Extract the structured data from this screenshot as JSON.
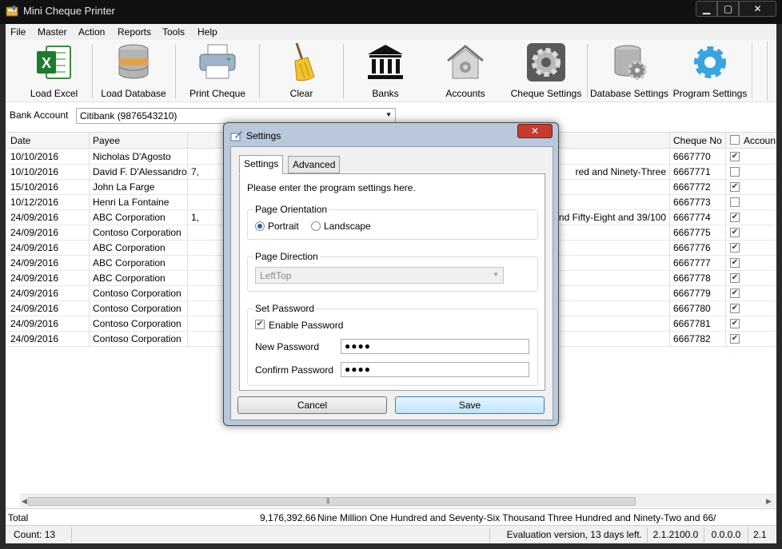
{
  "window": {
    "title": "Mini Cheque Printer",
    "minimize": "▁",
    "maximize": "▢",
    "close": "✕"
  },
  "menu": [
    "File",
    "Master",
    "Action",
    "Reports",
    "Tools",
    "Help"
  ],
  "toolbar": [
    {
      "label": "Load Excel",
      "icon": "excel-icon"
    },
    {
      "label": "Load Database",
      "icon": "database-icon"
    },
    {
      "label": "Print Cheque",
      "icon": "printer-icon"
    },
    {
      "label": "Clear",
      "icon": "broom-icon"
    },
    {
      "label": "Banks",
      "icon": "bank-icon"
    },
    {
      "label": "Accounts",
      "icon": "accounts-house-icon"
    },
    {
      "label": "Cheque Settings",
      "icon": "gear-icon"
    },
    {
      "label": "Database Settings",
      "icon": "database-settings-icon"
    },
    {
      "label": "Program Settings",
      "icon": "program-settings-gear-icon"
    }
  ],
  "bank_account": {
    "label": "Bank Account",
    "value": "Citibank (9876543210)"
  },
  "grid": {
    "headers": {
      "date": "Date",
      "payee": "Payee",
      "cheque_no": "Cheque No",
      "account": "Accoun"
    },
    "rows": [
      {
        "date": "10/10/2016",
        "payee": "Nicholas D'Agosto",
        "amount": "",
        "words": "",
        "cheque_no": "6667770",
        "checked": true
      },
      {
        "date": "10/10/2016",
        "payee": "David F. D'Alessandro",
        "amount": "7,",
        "words": "red and Ninety-Three",
        "cheque_no": "6667771",
        "checked": false
      },
      {
        "date": "15/10/2016",
        "payee": "John La Farge",
        "amount": "",
        "words": "",
        "cheque_no": "6667772",
        "checked": true
      },
      {
        "date": "10/12/2016",
        "payee": "Henri La Fontaine",
        "amount": "",
        "words": "",
        "cheque_no": "6667773",
        "checked": false
      },
      {
        "date": "24/09/2016",
        "payee": "ABC Corporation",
        "amount": "1,",
        "words": "nd Fifty-Eight and 39/100",
        "cheque_no": "6667774",
        "checked": true
      },
      {
        "date": "24/09/2016",
        "payee": "Contoso Corporation",
        "amount": "",
        "words": "",
        "cheque_no": "6667775",
        "checked": true
      },
      {
        "date": "24/09/2016",
        "payee": "ABC Corporation",
        "amount": "",
        "words": "",
        "cheque_no": "6667776",
        "checked": true
      },
      {
        "date": "24/09/2016",
        "payee": "ABC Corporation",
        "amount": "",
        "words": "",
        "cheque_no": "6667777",
        "checked": true
      },
      {
        "date": "24/09/2016",
        "payee": "ABC Corporation",
        "amount": "",
        "words": "",
        "cheque_no": "6667778",
        "checked": true
      },
      {
        "date": "24/09/2016",
        "payee": "Contoso Corporation",
        "amount": "",
        "words": "",
        "cheque_no": "6667779",
        "checked": true
      },
      {
        "date": "24/09/2016",
        "payee": "Contoso Corporation",
        "amount": "",
        "words": "",
        "cheque_no": "6667780",
        "checked": true
      },
      {
        "date": "24/09/2016",
        "payee": "Contoso Corporation",
        "amount": "",
        "words": "",
        "cheque_no": "6667781",
        "checked": true
      },
      {
        "date": "24/09/2016",
        "payee": "Contoso Corporation",
        "amount": "",
        "words": "",
        "cheque_no": "6667782",
        "checked": true
      }
    ]
  },
  "total": {
    "label": "Total",
    "amount": "9,176,392.66",
    "words": "Nine Million One Hundred and Seventy-Six Thousand Three Hundred and Ninety-Two and 66/"
  },
  "status": {
    "count": "Count: 13",
    "evaluation": "Evaluation version, 13 days left.",
    "version1": "2.1.2100.0",
    "version2": "0.0.0.0",
    "version3": "2.1"
  },
  "dialog": {
    "title": "Settings",
    "close": "✕",
    "tabs": {
      "settings": "Settings",
      "advanced": "Advanced"
    },
    "intro": "Please enter the program settings here.",
    "orientation": {
      "title": "Page Orientation",
      "portrait": "Portrait",
      "landscape": "Landscape",
      "selected": "Portrait"
    },
    "direction": {
      "title": "Page Direction",
      "value": "LeftTop"
    },
    "password": {
      "title": "Set Password",
      "enable_label": "Enable Password",
      "enabled": true,
      "new_label": "New Password",
      "new_value": "●●●●",
      "confirm_label": "Confirm Password",
      "confirm_value": "●●●●"
    },
    "buttons": {
      "cancel": "Cancel",
      "save": "Save"
    }
  },
  "colors": {
    "dialog_frame": "#b9c8da",
    "save_button": "#bee6fd",
    "close_button": "#c43b2f",
    "checkbox_mark": "#1d3d6c"
  }
}
